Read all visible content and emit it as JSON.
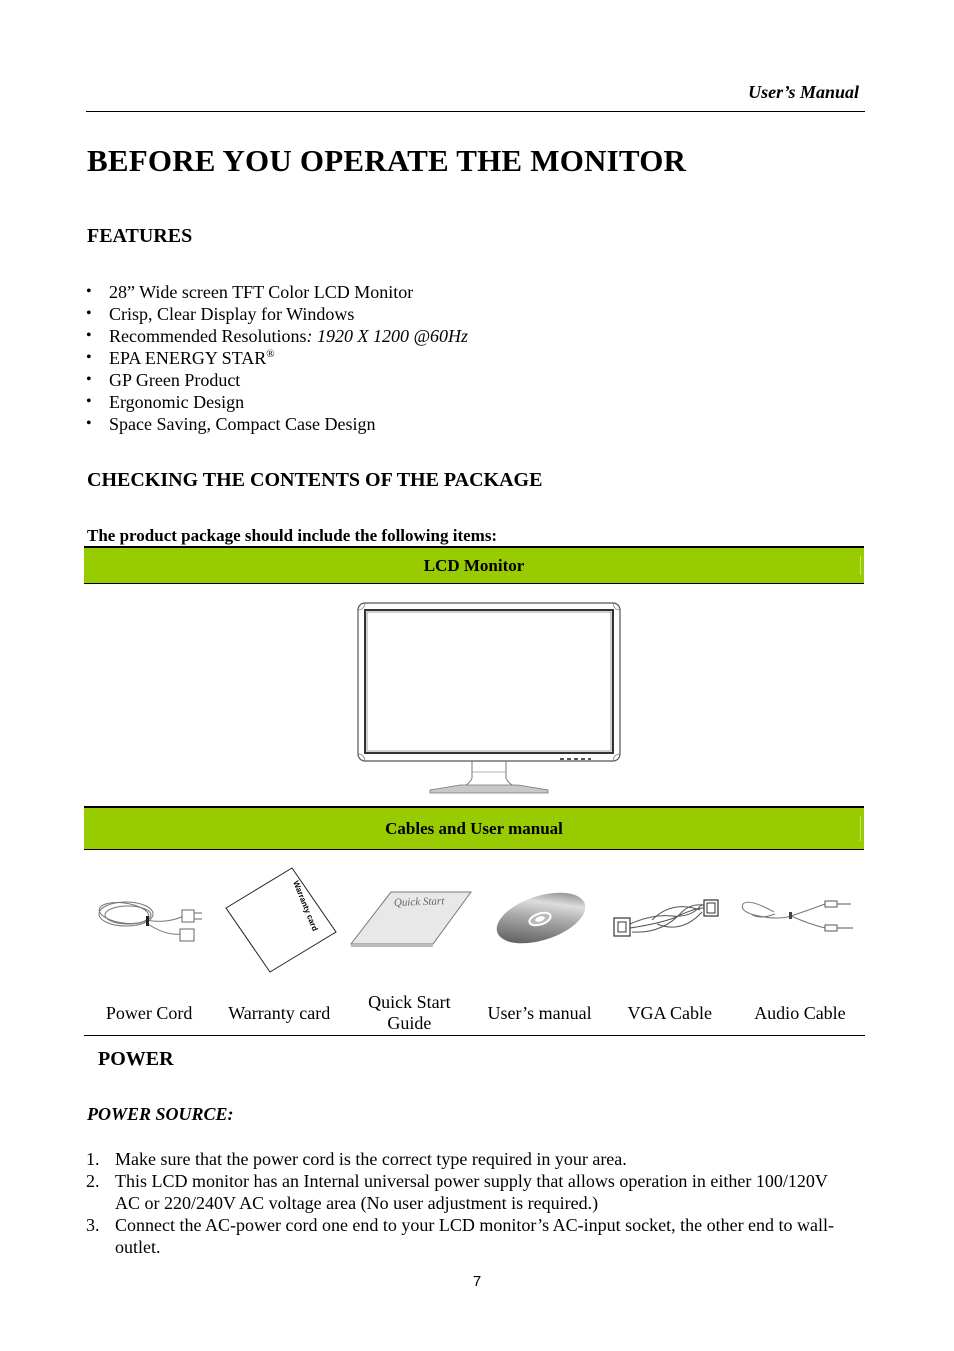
{
  "header": {
    "title": "User’s Manual"
  },
  "page_title": "BEFORE YOU OPERATE THE MONITOR",
  "features": {
    "heading": "FEATURES",
    "items": [
      {
        "text": "28” Wide screen TFT Color LCD Monitor"
      },
      {
        "text": "Crisp, Clear Display for Windows"
      },
      {
        "text": "Recommended Resolutions",
        "italic_suffix": ": 1920 X 1200 @60Hz"
      },
      {
        "text": "EPA ENERGY STAR",
        "superscript": "®"
      },
      {
        "text": "GP Green Product"
      },
      {
        "text": "Ergonomic Design"
      },
      {
        "text": "Space Saving, Compact Case Design"
      }
    ]
  },
  "package": {
    "heading": "CHECKING THE CONTENTS OF THE PACKAGE",
    "intro": "The product package should include the following items:",
    "band_color": "#99cc00",
    "monitor_band": "LCD Monitor",
    "cables_band": "Cables and User manual",
    "items": [
      {
        "label": "Power Cord",
        "icon": "power-cord-icon"
      },
      {
        "label": "Warranty card",
        "icon": "warranty-card-icon",
        "card_text": "Warranty card"
      },
      {
        "label_line1": "Quick Start",
        "label_line2": "Guide",
        "icon": "quick-start-guide-icon",
        "cover_text": "Quick Start"
      },
      {
        "label": "User’s manual",
        "icon": "cd-disc-icon"
      },
      {
        "label": "VGA Cable",
        "icon": "vga-cable-icon"
      },
      {
        "label": "Audio Cable",
        "icon": "audio-cable-icon"
      }
    ]
  },
  "power": {
    "heading": "POWER",
    "subheading": "POWER SOURCE:",
    "steps": [
      {
        "num": "1.",
        "text": "Make sure that the power cord is the correct type required in your area."
      },
      {
        "num": "2.",
        "text": "This LCD monitor has an Internal universal power supply that allows operation in either 100/120V AC or 220/240V AC voltage area (No user adjustment is required.)"
      },
      {
        "num": "3.",
        "text": "Connect the AC-power cord one end to your LCD monitor’s AC-input socket, the other end to wall-outlet."
      }
    ]
  },
  "page_number": "7"
}
